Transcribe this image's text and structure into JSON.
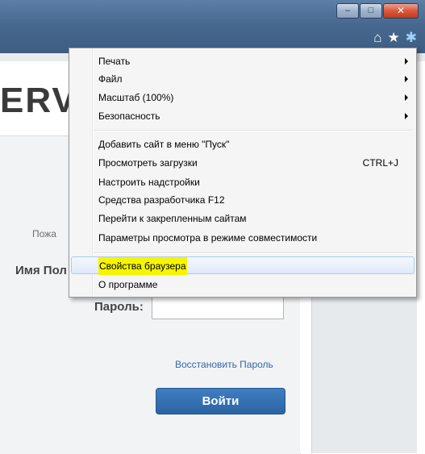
{
  "window": {
    "minimize_glyph": "–",
    "maximize_glyph": "□",
    "close_glyph": "✕"
  },
  "toolbar": {
    "home_icon": "⌂",
    "favorites_icon": "★",
    "tools_icon": "✱"
  },
  "page": {
    "brand_fragment": "ERVI",
    "greeting_fragment": "Пожа",
    "username_label_fragment": "Имя Пол",
    "password_label": "Пароль:",
    "password_value": "",
    "restore_link": "Восстановить Пароль",
    "login_button": "Войти"
  },
  "menu": {
    "items": [
      {
        "label": "Печать",
        "has_submenu": true
      },
      {
        "label": "Файл",
        "has_submenu": true
      },
      {
        "label": "Масштаб (100%)",
        "has_submenu": true
      },
      {
        "label": "Безопасность",
        "has_submenu": true
      },
      {
        "label": "Добавить сайт в меню \"Пуск\""
      },
      {
        "label": "Просмотреть загрузки",
        "shortcut": "CTRL+J"
      },
      {
        "label": "Настроить надстройки"
      },
      {
        "label": "Средства разработчика F12"
      },
      {
        "label": "Перейти к закрепленным сайтам"
      },
      {
        "label": "Параметры просмотра в режиме совместимости"
      },
      {
        "label": "Свойства браузера",
        "highlighted": true
      },
      {
        "label": "О программе"
      }
    ]
  },
  "colors": {
    "highlight_marker": "#f5f500",
    "title_bar": "#48698f",
    "login_button": "#2b64a3",
    "link": "#3568a8"
  }
}
